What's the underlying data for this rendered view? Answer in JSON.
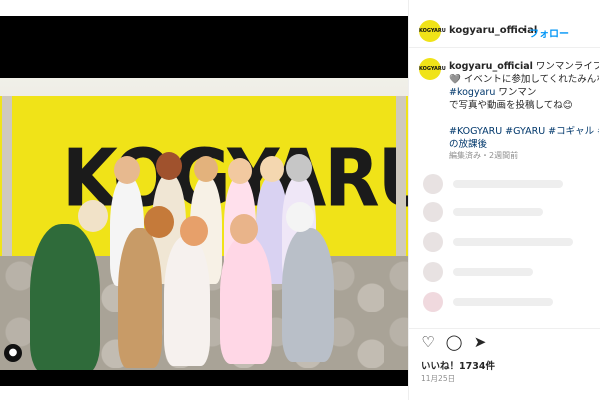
{
  "account": {
    "avatar_text": "KOGYARU",
    "username": "kogyaru_official",
    "separator": "•",
    "follow_label": "フォロー"
  },
  "photo": {
    "banner_text": "KOGYARU"
  },
  "caption": {
    "line1": "ワンマンライブ二日",
    "line2": "🩶 イベントに参加してくれたみんな",
    "line3_tag": "#kogyaru",
    "line3_rest": "ワンマン",
    "line4": "で写真や動画を投稿してね😊",
    "hashtags": "#KOGYARU #GYARU #コギャル #ギャ",
    "hashtags_tail": "の放課後",
    "meta": "編集済み・2週間前"
  },
  "engagement": {
    "likes": "いいね！1734件",
    "date": "11月25日"
  },
  "colors": {
    "brand_yellow": "#f0e318",
    "link_blue": "#0095f6",
    "hashtag_blue": "#00376b"
  }
}
